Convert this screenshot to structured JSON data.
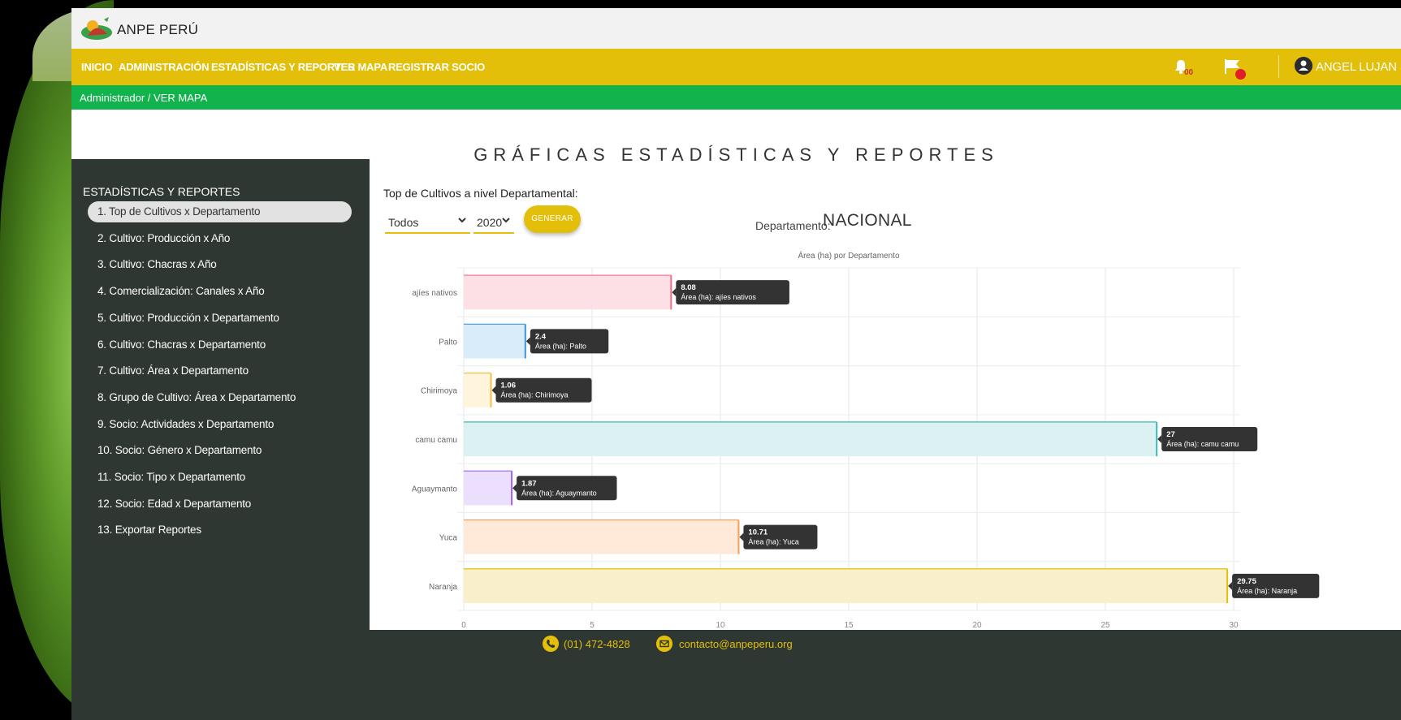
{
  "brand": {
    "name": "ANPE PERÚ"
  },
  "nav": {
    "items": [
      "INICIO",
      "ADMINISTRACIÓN",
      "ESTADÍSTICAS Y REPORTES",
      "VER MAPA",
      "REGISTRAR SOCIO"
    ],
    "notification_count": "00",
    "user_name": "ANGEL LUJAN SANCHEZ"
  },
  "breadcrumb": "Administrador / VER MAPA",
  "page_title": "GRÁFICAS ESTADÍSTICAS Y REPORTES",
  "sidebar": {
    "title": "ESTADÍSTICAS Y REPORTES",
    "active_index": 0,
    "items": [
      "1. Top de Cultivos x Departamento",
      "2. Cultivo: Producción x Año",
      "3. Cultivo: Chacras x Año",
      "4. Comercialización: Canales x Año",
      "5. Cultivo: Producción x Departamento",
      "6. Cultivo: Chacras x Departamento",
      "7. Cultivo: Área x Departamento",
      "8. Grupo de Cultivo: Área x Departamento",
      "9. Socio: Actividades x Departamento",
      "10. Socio: Género x Departamento",
      "11. Socio: Tipo x Departamento",
      "12. Socio: Edad x Departamento",
      "13. Exportar Reportes"
    ]
  },
  "content": {
    "heading": "Top de Cultivos a nivel Departamental:",
    "department_select": "Todos",
    "year_select": "2020",
    "generate_label": "GENERAR",
    "department_label": "Departamento:",
    "department_value": "NACIONAL"
  },
  "chart_data": {
    "type": "bar",
    "orientation": "horizontal",
    "title": "Área (ha) por Departamento",
    "tooltip_prefix": "Área (ha): ",
    "categories": [
      "ajíes nativos",
      "Palto",
      "Chirimoya",
      "camu camu",
      "Aguaymanto",
      "Yuca",
      "Naranja"
    ],
    "values": [
      8.08,
      2.4,
      1.06,
      27,
      1.87,
      10.71,
      29.75
    ],
    "value_labels": [
      "8.08",
      "2.4",
      "1.06",
      "27",
      "1.87",
      "10.71",
      "29.75"
    ],
    "xlim": [
      0,
      30
    ],
    "xticks": [
      "0",
      "5",
      "10",
      "15",
      "20",
      "25",
      "30"
    ],
    "grid": true,
    "colors": [
      {
        "fill": "#fde0e6",
        "stroke": "#f06e8c"
      },
      {
        "fill": "#d8ecfa",
        "stroke": "#3d97d6"
      },
      {
        "fill": "#fff4dc",
        "stroke": "#f5c046"
      },
      {
        "fill": "#dcf2f2",
        "stroke": "#3cb7b7"
      },
      {
        "fill": "#ebdffd",
        "stroke": "#9a66f0"
      },
      {
        "fill": "#ffe9d8",
        "stroke": "#f5a055"
      },
      {
        "fill": "#faefcb",
        "stroke": "#e3bf0a"
      }
    ]
  },
  "footer": {
    "phone": "(01) 472-4828",
    "email": "contacto@anpeperu.org"
  },
  "colors": {
    "brand_yellow": "#e3bf0a",
    "brand_green": "#12b34d",
    "sidebar_bg": "#2f3732"
  }
}
